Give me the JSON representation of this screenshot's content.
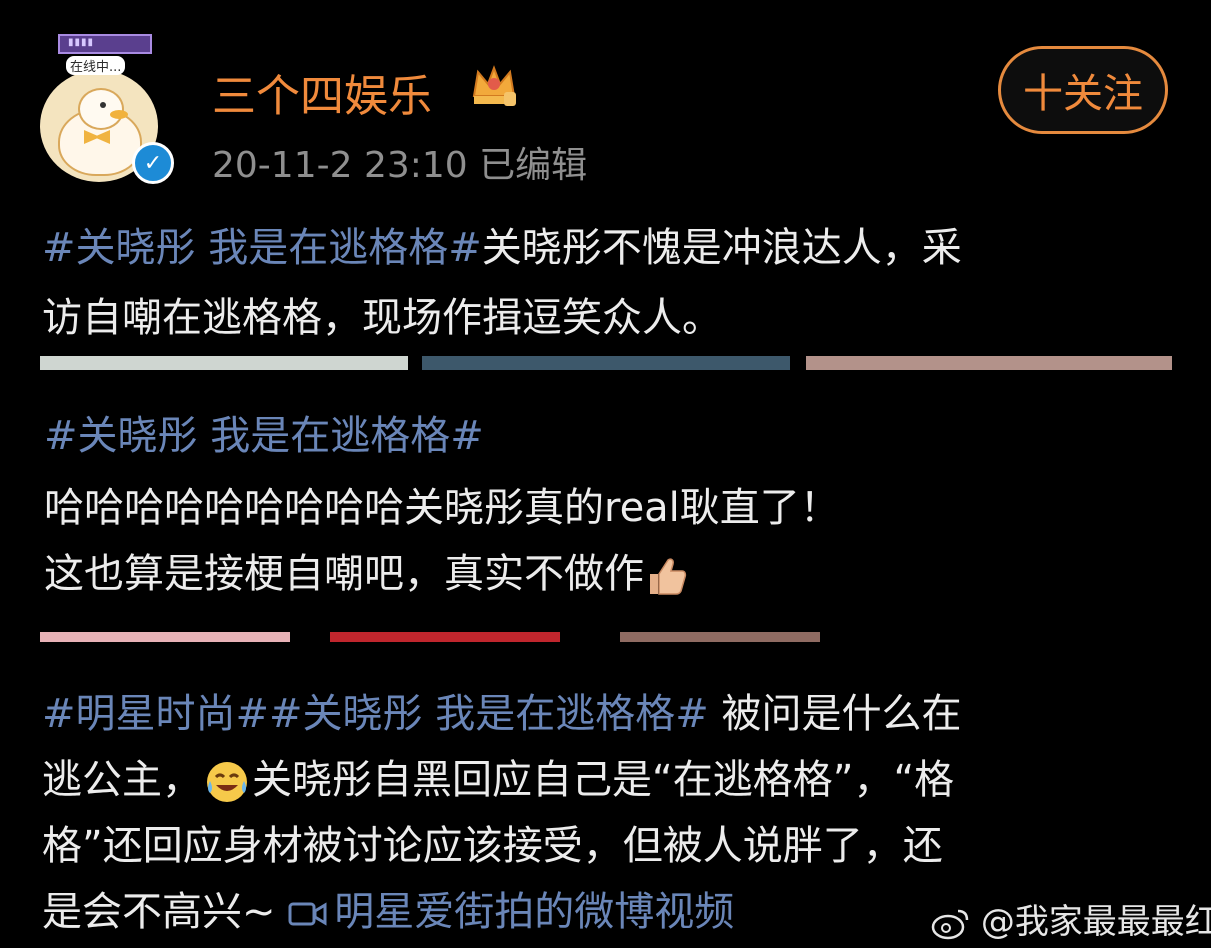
{
  "header": {
    "avatar_tag_text": "在线中...",
    "account_name": "三个四娱乐",
    "crown_icon": "crown-icon",
    "verify_icon": "verified-icon",
    "post_time": "20-11-2 23:10  已编辑",
    "follow_label": "十关注"
  },
  "post1": {
    "hashtag": "#关晓彤 我是在逃格格#",
    "line1_rest": "关晓彤不愧是冲浪达人，采",
    "line2": "访自嘲在逃格格，现场作揖逗笑众人。"
  },
  "post2": {
    "hashtag": "#关晓彤 我是在逃格格#",
    "line1": "哈哈哈哈哈哈哈哈哈关晓彤真的real耿直了！",
    "line2": "这也算是接梗自嘲吧，真实不做作",
    "thumb_icon": "thumbs-up-icon"
  },
  "post3": {
    "line1_tags": "#明星时尚##关晓彤 我是在逃格格#",
    "line1_rest": " 被问是什么在",
    "line2_a": "逃公主，",
    "line2_b": "关晓彤自黑回应自己是“在逃格格”，“格",
    "line3": "格”还回应身材被讨论应该接受，但被人说胖了，还",
    "line4_a": "是会不高兴~ ",
    "video_link": "明星爱街拍的微博视频",
    "laugh_icon": "laughing-crying-icon",
    "video_icon": "video-camera-icon"
  },
  "watermark": "@我家最最最红",
  "colors": {
    "background": "#000000",
    "accent_orange": "#f08a3c",
    "hashtag_blue": "#6a86b8",
    "text": "#ececec",
    "muted": "#8f8f8f"
  }
}
